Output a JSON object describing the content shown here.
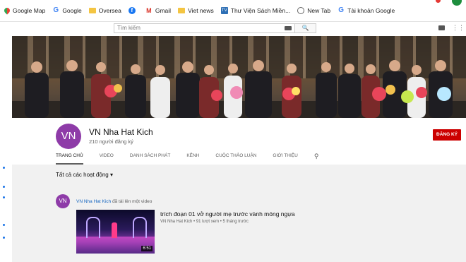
{
  "bookmarks": [
    {
      "label": "Google Map",
      "icon": "map-pin-icon"
    },
    {
      "label": "Google",
      "icon": "google-icon"
    },
    {
      "label": "Oversea",
      "icon": "folder-icon"
    },
    {
      "label": "",
      "icon": "facebook-icon"
    },
    {
      "label": "Gmail",
      "icon": "gmail-icon"
    },
    {
      "label": "Viet news",
      "icon": "folder-icon"
    },
    {
      "label": "Thư Viện Sách Miền...",
      "icon": "library-icon"
    },
    {
      "label": "New Tab",
      "icon": "globe-icon"
    },
    {
      "label": "Tài khoản Google",
      "icon": "google-icon"
    }
  ],
  "masthead": {
    "search_placeholder": "Tìm kiếm",
    "search_button": "🔍"
  },
  "channel": {
    "avatar_text": "VN",
    "name": "VN Nha Hat Kich",
    "subscribers": "210 người đăng ký",
    "subscribe_label": "ĐĂNG KÝ"
  },
  "tabs": [
    "TRANG CHỦ",
    "VIDEO",
    "DANH SÁCH PHÁT",
    "KÊNH",
    "CUỘC THẢO LUẬN",
    "GIỚI THIỆU"
  ],
  "feed": {
    "filter_label": "Tất cả các hoạt động",
    "filter_caret": "▾",
    "activity_channel": "VN Nha Hat Kich",
    "activity_text": " đã tải lên một video",
    "video": {
      "title": "trích đoạn 01 vở người mẹ trước vành móng ngựa",
      "meta": "VN Nha Hat Kich • 91 lượt xem • 5 tháng trước",
      "duration": "6:51"
    }
  },
  "colors": {
    "accent_red": "#cc0000",
    "avatar_purple": "#8e3ba8",
    "link_blue": "#1565c0"
  }
}
